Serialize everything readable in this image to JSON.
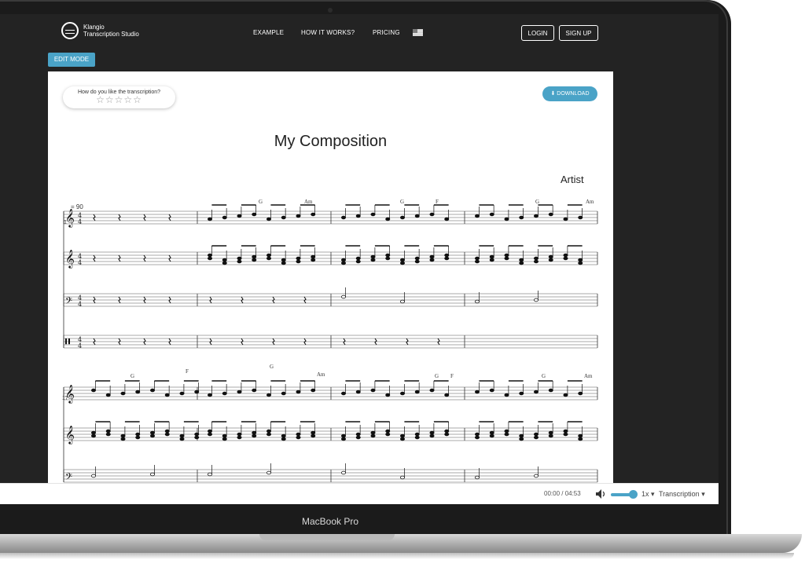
{
  "nav": {
    "logo_line1": "Klangio",
    "logo_line2": "Transcription Studio",
    "links": [
      "EXAMPLE",
      "HOW IT WORKS?",
      "PRICING"
    ],
    "language_flag": "us-flag-icon",
    "login_label": "LOGIN",
    "signup_label": "SIGN UP"
  },
  "edit_mode_label": "EDIT MODE",
  "rating": {
    "question": "How do you like the transcription?",
    "stars": "☆☆☆☆☆"
  },
  "download_label": "DOWNLOAD",
  "score": {
    "title": "My Composition",
    "artist": "Artist",
    "tempo": "= 90",
    "system1_measure_number": "1",
    "system2_measure_number": "17",
    "time_signature": "4 4",
    "system1_chords": [
      "G",
      "Am",
      "G",
      "F",
      "G",
      "Am"
    ],
    "system2_chords": [
      "G",
      "F",
      "G",
      "Am",
      "G",
      "F",
      "G",
      "Am"
    ]
  },
  "player": {
    "time": "00:00 / 04:53",
    "volume_level": 0.85,
    "speed": "1x",
    "view_label": "Transcription"
  },
  "device_label": "MacBook Pro"
}
